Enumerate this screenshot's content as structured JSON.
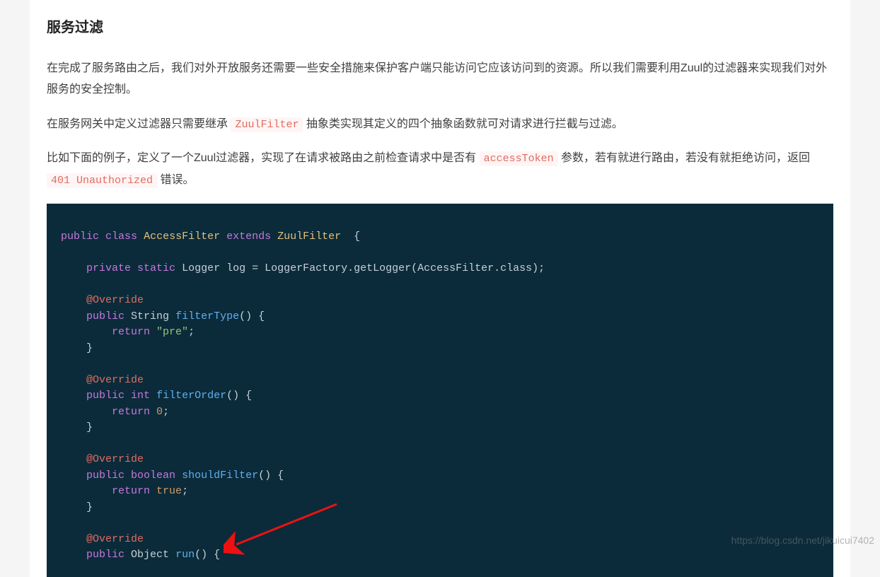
{
  "heading": "服务过滤",
  "para1": "在完成了服务路由之后，我们对外开放服务还需要一些安全措施来保护客户端只能访问它应该访问到的资源。所以我们需要利用Zuul的过滤器来实现我们对外服务的安全控制。",
  "para2_a": "在服务网关中定义过滤器只需要继承 ",
  "para2_code": "ZuulFilter",
  "para2_b": " 抽象类实现其定义的四个抽象函数就可对请求进行拦截与过滤。",
  "para3_a": "比如下面的例子，定义了一个Zuul过滤器，实现了在请求被路由之前检查请求中是否有 ",
  "para3_code1": "accessToken",
  "para3_b": " 参数，若有就进行路由，若没有就拒绝访问，返回 ",
  "para3_code2": "401 Unauthorized",
  "para3_c": " 错误。",
  "code": {
    "kw_public": "public",
    "kw_class": "class",
    "type_AccessFilter": "AccessFilter",
    "kw_extends": "extends",
    "type_ZuulFilter": "ZuulFilter",
    "brace_open": "{",
    "brace_close": "}",
    "kw_private": "private",
    "kw_static": "static",
    "plain_logger_decl": "Logger log = LoggerFactory.getLogger(AccessFilter.class);",
    "ann_override": "@Override",
    "plain_string": "String",
    "fn_filterType": "filterType",
    "paren_empty": "()",
    "kw_return": "return",
    "str_pre": "\"pre\"",
    "semi": ";",
    "kw_int": "int",
    "fn_filterOrder": "filterOrder",
    "num_0": "0",
    "kw_boolean": "boolean",
    "fn_shouldFilter": "shouldFilter",
    "bool_true": "true",
    "plain_object": "Object",
    "fn_run": "run"
  },
  "watermark": "https://blog.csdn.net/jikuicui7402"
}
